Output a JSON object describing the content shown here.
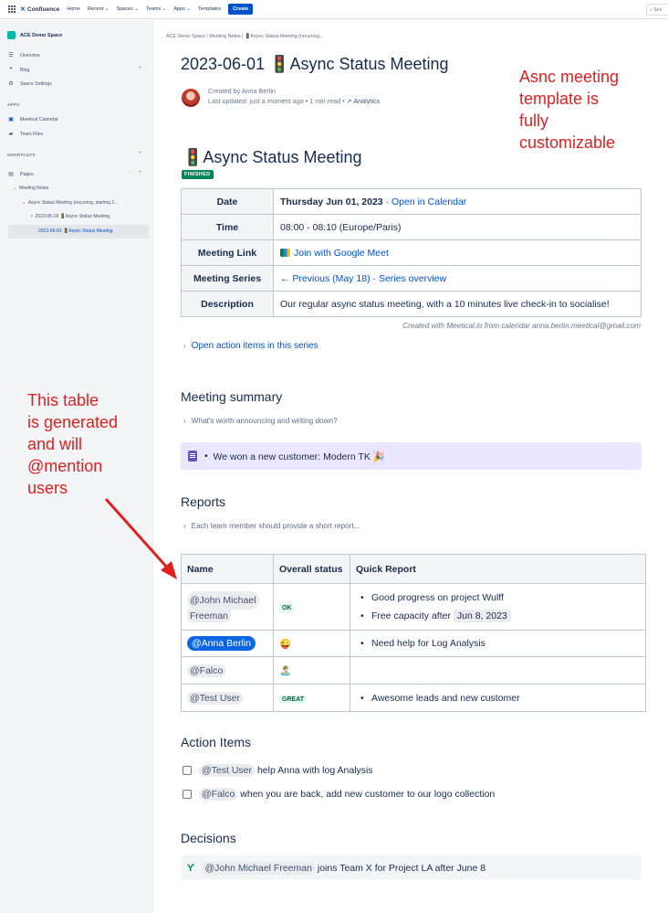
{
  "topnav": {
    "product": "Confluence",
    "items": [
      "Home",
      "Recent ⌄",
      "Spaces ⌄",
      "Teams ⌄",
      "Apps ⌄",
      "Templates"
    ],
    "create": "Create",
    "search_placeholder": "Sea"
  },
  "sidebar": {
    "space_name": "ACE Demo Space",
    "items": [
      "Overview",
      "Blog",
      "Space Settings"
    ],
    "apps_heading": "APPS",
    "apps": [
      "Meetical Calendar",
      "Team Files"
    ],
    "shortcuts_heading": "SHORTCUTS",
    "pages_label": "Pages",
    "tree": [
      "Meeting Notes",
      "Async Status Meeting (recurring, starting 2...",
      "2023-05-18 🚦Async Status Meeting",
      "2023-06-01 🚦Async Status Meeting"
    ]
  },
  "page": {
    "breadcrumb": "ACE Demo Space  /  Meeting Notes  /  🚦Async Status Meeting (recurring...",
    "title": "2023-06-01 🚦Async Status Meeting",
    "created_by": "Created by Anna Berlin",
    "last_updated": "Last updated: just a moment ago  •  1 min read  •",
    "analytics": "Analytics"
  },
  "annotations": {
    "top_right": "Asnc meeting\ntemplate is\nfully\ncustomizable",
    "left": "This table\nis generated\nand will\n@mention\nusers"
  },
  "meeting": {
    "title": "🚦Async Status Meeting",
    "status": "FINISHED",
    "rows": [
      {
        "label": "Date",
        "value": "Thursday Jun 01, 2023",
        "link": "Open in Calendar"
      },
      {
        "label": "Time",
        "value": "08:00 - 08:10 (Europe/Paris)"
      },
      {
        "label": "Meeting Link",
        "link": "Join with Google Meet"
      },
      {
        "label": "Meeting Series",
        "prev": "← Previous (May 18)",
        "overview": "Series overview"
      },
      {
        "label": "Description",
        "value": "Our regular async status meeting, with a 10 minutes live check-in to socialise!"
      }
    ],
    "created_with": "Created with Meetical.io from calendar anna.berlin.meetical@gmail.com",
    "open_actions": "Open action items in this series"
  },
  "summary": {
    "title": "Meeting summary",
    "expand": "What's worth announcing and writing down?",
    "note": "We won a new customer: Modern TK 🎉"
  },
  "reports": {
    "title": "Reports",
    "expand": "Each team member should provide a short report...",
    "headers": [
      "Name",
      "Overall status",
      "Quick Report"
    ],
    "rows": [
      {
        "name": "@John Michael",
        "name2": "Freeman",
        "status": "OK",
        "reports": [
          "Good progress on project Wulff",
          "Free capacity after"
        ],
        "date": "Jun 8, 2023"
      },
      {
        "name": "@Anna Berlin",
        "status_emoji": "😜",
        "reports": [
          "Need help for Log Analysis"
        ]
      },
      {
        "name": "@Falco",
        "status_emoji": "🏝️",
        "reports": []
      },
      {
        "name": "@Test User",
        "status": "GREAT",
        "reports": [
          "Awesome leads and new customer"
        ]
      }
    ]
  },
  "actions": {
    "title": "Action Items",
    "items": [
      {
        "mention": "@Test User",
        "text": "help Anna with log Analysis"
      },
      {
        "mention": "@Falco",
        "text": "when you are back, add new customer to our logo collection"
      }
    ]
  },
  "decisions": {
    "title": "Decisions",
    "mention": "@John Michael Freeman",
    "text": "joins Team X for Project LA after June 8"
  },
  "colors": {
    "brand": "#0052cc",
    "annotation": "#e02020",
    "finished": "#00875a",
    "panel": "#eae6ff"
  }
}
